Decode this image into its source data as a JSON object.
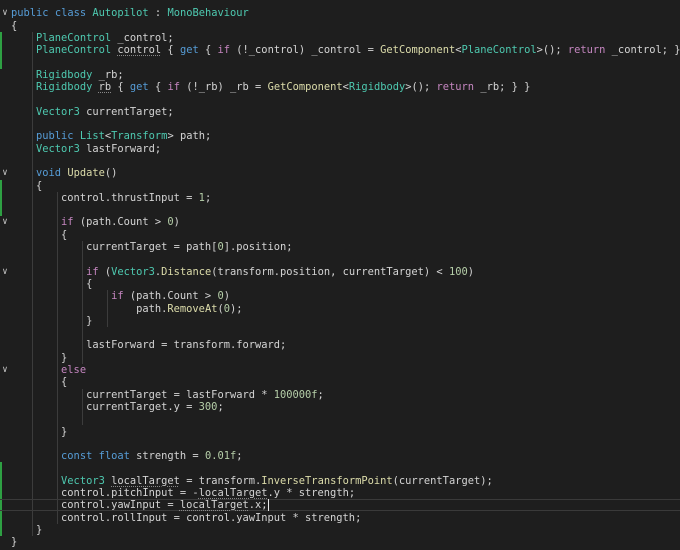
{
  "editor": {
    "language": "C#",
    "colors": {
      "background": "#1e1e1e",
      "keyword": "#569cd6",
      "control": "#c586c0",
      "type": "#4ec9b0",
      "function": "#dcdcaa",
      "number": "#b5cea8",
      "text": "#d4d4d4"
    },
    "lines": [
      {
        "fold": "open",
        "tokens": [
          {
            "t": "public",
            "c": "kw"
          },
          {
            "t": " "
          },
          {
            "t": "class",
            "c": "kw"
          },
          {
            "t": " "
          },
          {
            "t": "Autopilot",
            "c": "type"
          },
          {
            "t": " : "
          },
          {
            "t": "MonoBehaviour",
            "c": "type"
          }
        ]
      },
      {
        "tokens": [
          {
            "t": "{"
          }
        ]
      },
      {
        "tokens": [
          {
            "t": "    "
          },
          {
            "t": "PlaneControl",
            "c": "type"
          },
          {
            "t": " _control;"
          }
        ]
      },
      {
        "tokens": [
          {
            "t": "    "
          },
          {
            "t": "PlaneControl",
            "c": "type"
          },
          {
            "t": " "
          },
          {
            "t": "control",
            "c": "sq"
          },
          {
            "t": " { "
          },
          {
            "t": "get",
            "c": "kw"
          },
          {
            "t": " { "
          },
          {
            "t": "if",
            "c": "ctl"
          },
          {
            "t": " (!_control) _control = "
          },
          {
            "t": "GetComponent",
            "c": "fn"
          },
          {
            "t": "<"
          },
          {
            "t": "PlaneControl",
            "c": "type"
          },
          {
            "t": ">(); "
          },
          {
            "t": "return",
            "c": "ctl"
          },
          {
            "t": " _control; } }"
          }
        ]
      },
      {
        "tokens": []
      },
      {
        "tokens": [
          {
            "t": "    "
          },
          {
            "t": "Rigidbody",
            "c": "type"
          },
          {
            "t": " _rb;"
          }
        ]
      },
      {
        "tokens": [
          {
            "t": "    "
          },
          {
            "t": "Rigidbody",
            "c": "type"
          },
          {
            "t": " "
          },
          {
            "t": "rb",
            "c": "sq"
          },
          {
            "t": " { "
          },
          {
            "t": "get",
            "c": "kw"
          },
          {
            "t": " { "
          },
          {
            "t": "if",
            "c": "ctl"
          },
          {
            "t": " (!_rb) _rb = "
          },
          {
            "t": "GetComponent",
            "c": "fn"
          },
          {
            "t": "<"
          },
          {
            "t": "Rigidbody",
            "c": "type"
          },
          {
            "t": ">(); "
          },
          {
            "t": "return",
            "c": "ctl"
          },
          {
            "t": " _rb; } }"
          }
        ]
      },
      {
        "tokens": []
      },
      {
        "tokens": [
          {
            "t": "    "
          },
          {
            "t": "Vector3",
            "c": "type"
          },
          {
            "t": " currentTarget;"
          }
        ]
      },
      {
        "tokens": []
      },
      {
        "tokens": [
          {
            "t": "    "
          },
          {
            "t": "public",
            "c": "kw"
          },
          {
            "t": " "
          },
          {
            "t": "List",
            "c": "type"
          },
          {
            "t": "<"
          },
          {
            "t": "Transform",
            "c": "type"
          },
          {
            "t": "> path;"
          }
        ]
      },
      {
        "tokens": [
          {
            "t": "    "
          },
          {
            "t": "Vector3",
            "c": "type"
          },
          {
            "t": " lastForward;"
          }
        ]
      },
      {
        "tokens": []
      },
      {
        "fold": "open",
        "tokens": [
          {
            "t": "    "
          },
          {
            "t": "void",
            "c": "kw"
          },
          {
            "t": " "
          },
          {
            "t": "Update",
            "c": "fn"
          },
          {
            "t": "()"
          }
        ]
      },
      {
        "tokens": [
          {
            "t": "    {"
          }
        ]
      },
      {
        "tokens": [
          {
            "t": "        control.thrustInput = "
          },
          {
            "t": "1",
            "c": "num"
          },
          {
            "t": ";"
          }
        ]
      },
      {
        "tokens": []
      },
      {
        "fold": "open",
        "tokens": [
          {
            "t": "        "
          },
          {
            "t": "if",
            "c": "ctl"
          },
          {
            "t": " (path.Count > "
          },
          {
            "t": "0",
            "c": "num"
          },
          {
            "t": ")"
          }
        ]
      },
      {
        "tokens": [
          {
            "t": "        {"
          }
        ]
      },
      {
        "tokens": [
          {
            "t": "            currentTarget = path["
          },
          {
            "t": "0",
            "c": "num"
          },
          {
            "t": "].position;"
          }
        ]
      },
      {
        "tokens": []
      },
      {
        "fold": "open",
        "tokens": [
          {
            "t": "            "
          },
          {
            "t": "if",
            "c": "ctl"
          },
          {
            "t": " ("
          },
          {
            "t": "Vector3",
            "c": "type"
          },
          {
            "t": "."
          },
          {
            "t": "Distance",
            "c": "fn"
          },
          {
            "t": "(transform.position, currentTarget) < "
          },
          {
            "t": "100",
            "c": "num"
          },
          {
            "t": ")"
          }
        ]
      },
      {
        "tokens": [
          {
            "t": "            {"
          }
        ]
      },
      {
        "tokens": [
          {
            "t": "                "
          },
          {
            "t": "if",
            "c": "ctl"
          },
          {
            "t": " (path.Count > "
          },
          {
            "t": "0",
            "c": "num"
          },
          {
            "t": ")"
          }
        ]
      },
      {
        "tokens": [
          {
            "t": "                    path."
          },
          {
            "t": "RemoveAt",
            "c": "fn"
          },
          {
            "t": "("
          },
          {
            "t": "0",
            "c": "num"
          },
          {
            "t": ");"
          }
        ]
      },
      {
        "tokens": [
          {
            "t": "            }"
          }
        ]
      },
      {
        "tokens": []
      },
      {
        "tokens": [
          {
            "t": "            lastForward = transform.forward;"
          }
        ]
      },
      {
        "tokens": [
          {
            "t": "        }"
          }
        ]
      },
      {
        "fold": "open",
        "tokens": [
          {
            "t": "        "
          },
          {
            "t": "else",
            "c": "ctl"
          }
        ]
      },
      {
        "tokens": [
          {
            "t": "        {"
          }
        ]
      },
      {
        "tokens": [
          {
            "t": "            currentTarget = lastForward * "
          },
          {
            "t": "100000f",
            "c": "num"
          },
          {
            "t": ";"
          }
        ]
      },
      {
        "tokens": [
          {
            "t": "            currentTarget.y = "
          },
          {
            "t": "300",
            "c": "num"
          },
          {
            "t": ";"
          }
        ]
      },
      {
        "tokens": []
      },
      {
        "tokens": [
          {
            "t": "        }"
          }
        ]
      },
      {
        "tokens": []
      },
      {
        "tokens": [
          {
            "t": "        "
          },
          {
            "t": "const",
            "c": "kw"
          },
          {
            "t": " "
          },
          {
            "t": "float",
            "c": "kw"
          },
          {
            "t": " strength = "
          },
          {
            "t": "0.01f",
            "c": "num"
          },
          {
            "t": ";"
          }
        ]
      },
      {
        "tokens": []
      },
      {
        "tokens": [
          {
            "t": "        "
          },
          {
            "t": "Vector3",
            "c": "type"
          },
          {
            "t": " "
          },
          {
            "t": "localTarget",
            "c": "sq"
          },
          {
            "t": " = transform."
          },
          {
            "t": "InverseTransformPoint",
            "c": "fn"
          },
          {
            "t": "(currentTarget);"
          }
        ]
      },
      {
        "tokens": [
          {
            "t": "        control.pitchInput = -"
          },
          {
            "t": "localTarget",
            "c": "sq"
          },
          {
            "t": ".y * strength;"
          }
        ]
      },
      {
        "current": true,
        "tokens": [
          {
            "t": "        control.yawInput = "
          },
          {
            "t": "localTarget",
            "c": "sq"
          },
          {
            "t": ".x;"
          }
        ]
      },
      {
        "tokens": [
          {
            "t": "        control.rollInput = control.yawInput * strength;"
          }
        ]
      },
      {
        "tokens": [
          {
            "t": "    }"
          }
        ]
      },
      {
        "tokens": [
          {
            "t": "}"
          }
        ]
      }
    ]
  }
}
